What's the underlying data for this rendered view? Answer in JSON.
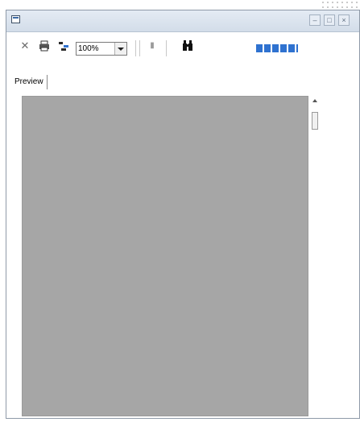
{
  "titlebar": {
    "title": "",
    "icon": "window-icon",
    "buttons": [
      "minimize",
      "maximize",
      "close"
    ]
  },
  "toolbar": {
    "close_icon": "close-icon",
    "print_icon": "printer-icon",
    "page_setup_icon": "page-setup-icon",
    "zoom": {
      "value": "100%",
      "options_visible": [
        "100%"
      ]
    },
    "pagination_icon": "single-page-icon",
    "find_icon": "binoculars-icon",
    "page_indicator_color": "#2f72d0"
  },
  "tabs": [
    {
      "label": "Preview",
      "active": true
    }
  ],
  "colors": {
    "canvas": "#a6a6a6",
    "titlebar": "#dbe3ee"
  }
}
